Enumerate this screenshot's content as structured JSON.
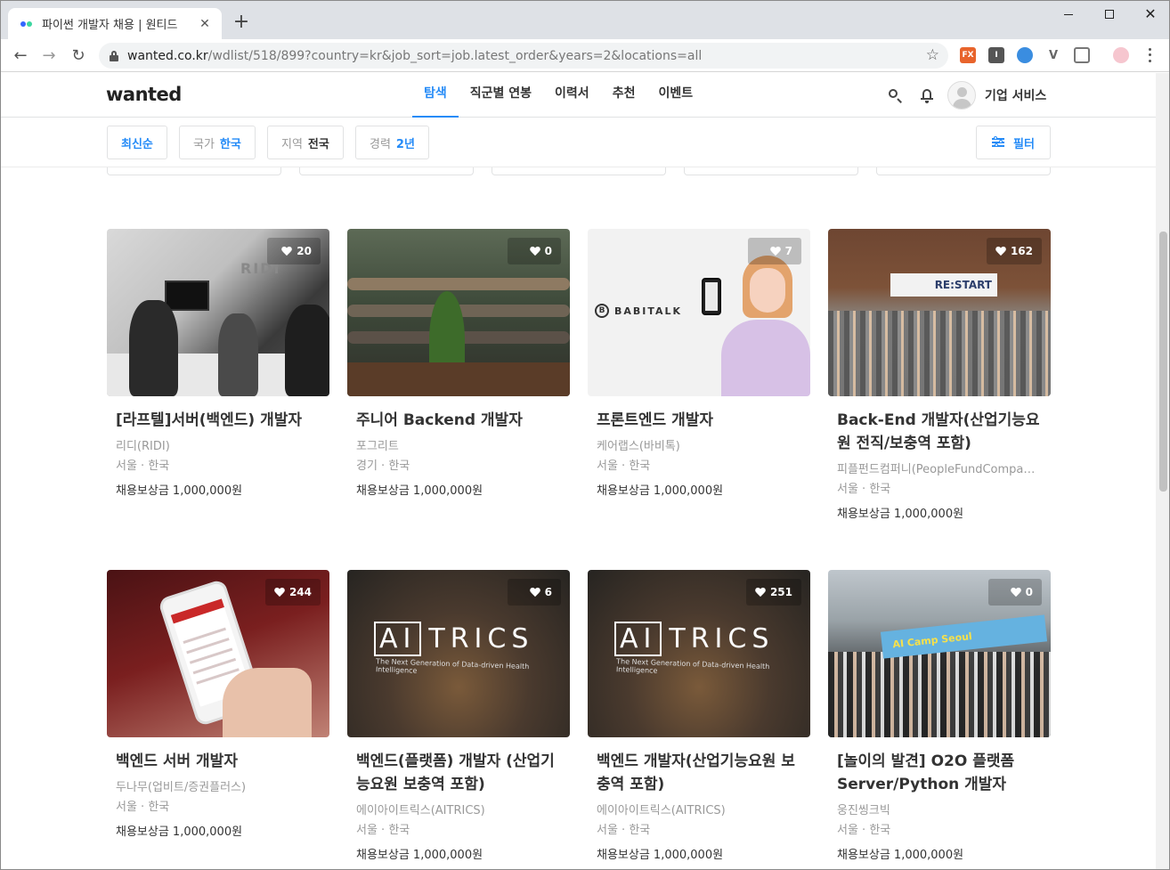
{
  "browser": {
    "tab_title": "파이썬 개발자 채용 | 원티드",
    "tab_close": "✕",
    "new_tab": "+",
    "url_host": "wanted.co.kr",
    "url_rest": "/wdlist/518/899?country=kr&job_sort=job.latest_order&years=2&locations=all",
    "back": "←",
    "forward": "→",
    "reload": "↻",
    "star": "☆",
    "ext_fx": "FX",
    "ext_i": "I",
    "ext_v": "V"
  },
  "header": {
    "logo": "wanted",
    "nav": [
      {
        "label": "탐색",
        "active": true
      },
      {
        "label": "직군별 연봉"
      },
      {
        "label": "이력서"
      },
      {
        "label": "추천"
      },
      {
        "label": "이벤트"
      }
    ],
    "business": "기업 서비스"
  },
  "filters": {
    "sort": "최신순",
    "country_label": "국가",
    "country_value": "한국",
    "region_label": "지역",
    "region_value": "전국",
    "career_label": "경력",
    "career_value": "2년",
    "filter_button": "필터"
  },
  "jobs": [
    {
      "likes": "20",
      "position": "[라프텔]서버(백엔드) 개발자",
      "company": "리디(RIDI)",
      "location": "서울 · 한국",
      "reward": "채용보상금 1,000,000원",
      "thumb_text": "RIDI"
    },
    {
      "likes": "0",
      "position": "주니어 Backend 개발자",
      "company": "포그리트",
      "location": "경기 · 한국",
      "reward": "채용보상금 1,000,000원"
    },
    {
      "likes": "7",
      "position": "프론트엔드 개발자",
      "company": "케어랩스(바비톡)",
      "location": "서울 · 한국",
      "reward": "채용보상금 1,000,000원",
      "thumb_text": "BABITALK",
      "thumb_mark": "B"
    },
    {
      "likes": "162",
      "position": "Back-End 개발자(산업기능요원 전직/보충역 포함)",
      "company": "피플펀드컴퍼니(PeopleFundCompany)",
      "location": "서울 · 한국",
      "reward": "채용보상금 1,000,000원",
      "thumb_text": "RE:START"
    },
    {
      "likes": "244",
      "position": "백엔드 서버 개발자",
      "company": "두나무(업비트/증권플러스)",
      "location": "서울 · 한국",
      "reward": "채용보상금 1,000,000원"
    },
    {
      "likes": "6",
      "position": "백엔드(플랫폼) 개발자 (산업기능요원 보충역 포함)",
      "company": "에이아이트릭스(AITRICS)",
      "location": "서울 · 한국",
      "reward": "채용보상금 1,000,000원",
      "thumb_text": "TRICS",
      "thumb_box": "AI",
      "thumb_tag": "The Next Generation of Data-driven Health Intelligence"
    },
    {
      "likes": "251",
      "position": "백엔드 개발자(산업기능요원 보충역 포함)",
      "company": "에이아이트릭스(AITRICS)",
      "location": "서울 · 한국",
      "reward": "채용보상금 1,000,000원",
      "thumb_text": "TRICS",
      "thumb_box": "AI",
      "thumb_tag": "The Next Generation of Data-driven Health Intelligence"
    },
    {
      "likes": "0",
      "position": "[놀이의 발견] O2O 플랫폼 Server/Python 개발자",
      "company": "웅진씽크빅",
      "location": "서울 · 한국",
      "reward": "채용보상금 1,000,000원",
      "thumb_text": "AI Camp Seoul"
    }
  ],
  "colors": {
    "accent": "#258bf7",
    "text": "#333333",
    "muted": "#999999"
  }
}
